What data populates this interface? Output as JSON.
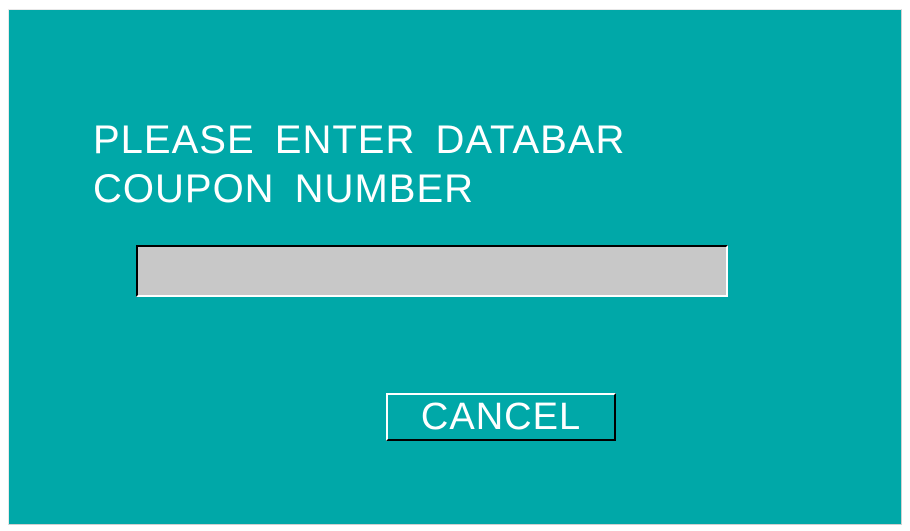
{
  "dialog": {
    "prompt_line1": "PLEASE ENTER DATABAR",
    "prompt_line2": "COUPON NUMBER",
    "coupon_input": {
      "value": "",
      "placeholder": ""
    },
    "cancel_label": "CANCEL"
  },
  "colors": {
    "background": "#00a8a8",
    "input_fill": "#c8c8c8",
    "text": "#ffffff"
  }
}
